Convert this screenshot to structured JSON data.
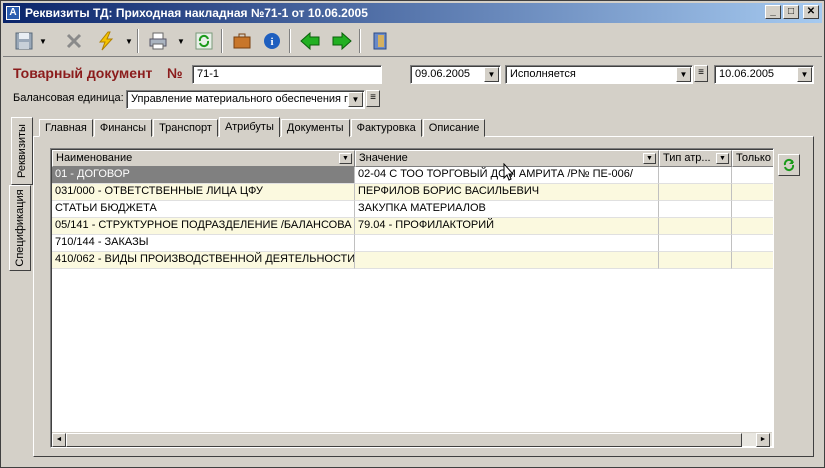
{
  "window": {
    "title": "Реквизиты ТД: Приходная накладная №71-1 от 10.06.2005",
    "controls": [
      "_",
      "□",
      "✕"
    ]
  },
  "toolbar": {
    "icons": [
      "save-icon",
      "delete-icon",
      "action-icon",
      "print-icon",
      "refresh-icon",
      "briefcase-icon",
      "info-icon",
      "back-icon",
      "forward-icon",
      "exit-icon"
    ]
  },
  "header": {
    "doc_label": "Товарный документ",
    "num_symbol": "№",
    "doc_number": "71-1",
    "date1": "09.06.2005",
    "status": "Исполняется",
    "date2": "10.06.2005",
    "balance_label": "Балансовая единица:",
    "balance_value": "Управление материального обеспечения г"
  },
  "side_tabs": [
    "Реквизиты",
    "Спецификация"
  ],
  "tabs": [
    "Главная",
    "Финансы",
    "Транспорт",
    "Атрибуты",
    "Документы",
    "Фактуровка",
    "Описание"
  ],
  "active_tab": "Атрибуты",
  "grid": {
    "columns": [
      "Наименование",
      "Значение",
      "Тип атр...",
      "Только"
    ],
    "rows": [
      {
        "name": "01 - ДОГОВОР",
        "value": "02-04  С ТОО ТОРГОВЫЙ ДОМ АМРИТА /Р№ ПЕ-006/",
        "type": "",
        "only": ""
      },
      {
        "name": "031/000 - ОТВЕТСТВЕННЫЕ ЛИЦА ЦФУ",
        "value": "ПЕРФИЛОВ БОРИС ВАСИЛЬЕВИЧ",
        "type": "",
        "only": ""
      },
      {
        "name": "СТАТЬИ БЮДЖЕТА",
        "value": "ЗАКУПКА МАТЕРИАЛОВ",
        "type": "",
        "only": ""
      },
      {
        "name": "05/141 - СТРУКТУРНОЕ ПОДРАЗДЕЛЕНИЕ /БАЛАНСОВА",
        "value": "79.04 - ПРОФИЛАКТОРИЙ",
        "type": "",
        "only": ""
      },
      {
        "name": "710/144 - ЗАКАЗЫ",
        "value": "",
        "type": "",
        "only": ""
      },
      {
        "name": "410/062 - ВИДЫ ПРОИЗВОДСТВЕННОЙ ДЕЯТЕЛЬНОСТИ",
        "value": "",
        "type": "",
        "only": ""
      }
    ]
  },
  "colors": {
    "title_start": "#0a246a",
    "title_end": "#a6caf0",
    "doc_label": "#8b1c1c",
    "row_alt": "#fbf9df",
    "row_selected": "#808080"
  }
}
